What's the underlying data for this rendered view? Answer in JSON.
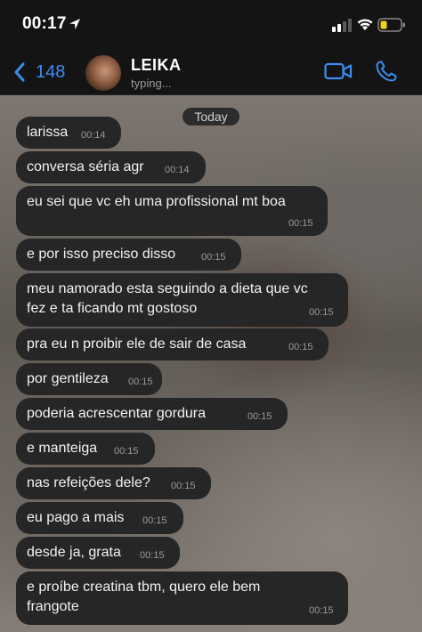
{
  "status_bar": {
    "time": "00:17"
  },
  "header": {
    "back_count": "148",
    "contact_name": "LEIKA",
    "contact_status": "typing..."
  },
  "chat": {
    "date_label": "Today",
    "messages": [
      {
        "lines": [
          "larissa"
        ],
        "time": "00:14"
      },
      {
        "lines": [
          "conversa séria agr"
        ],
        "time": "00:14"
      },
      {
        "lines": [
          "eu sei que vc eh uma profissional mt boa"
        ],
        "time": "00:15"
      },
      {
        "lines": [
          "e por isso preciso disso"
        ],
        "time": "00:15"
      },
      {
        "lines": [
          "meu namorado esta seguindo a dieta que vc",
          "fez e ta ficando mt gostoso"
        ],
        "time": "00:15"
      },
      {
        "lines": [
          "pra eu n proibir ele de sair de casa"
        ],
        "time": "00:15"
      },
      {
        "lines": [
          "por gentileza"
        ],
        "time": "00:15"
      },
      {
        "lines": [
          "poderia acrescentar gordura"
        ],
        "time": "00:15"
      },
      {
        "lines": [
          "e manteiga"
        ],
        "time": "00:15"
      },
      {
        "lines": [
          "nas refeições dele?"
        ],
        "time": "00:15"
      },
      {
        "lines": [
          "eu pago a mais"
        ],
        "time": "00:15"
      },
      {
        "lines": [
          "desde ja, grata"
        ],
        "time": "00:15"
      },
      {
        "lines": [
          "e proíbe creatina tbm, quero ele bem",
          "frangote"
        ],
        "time": "00:15"
      }
    ]
  },
  "colors": {
    "accent": "#3b8cf0",
    "bubble": "#262626",
    "battery": "#f5d020"
  }
}
